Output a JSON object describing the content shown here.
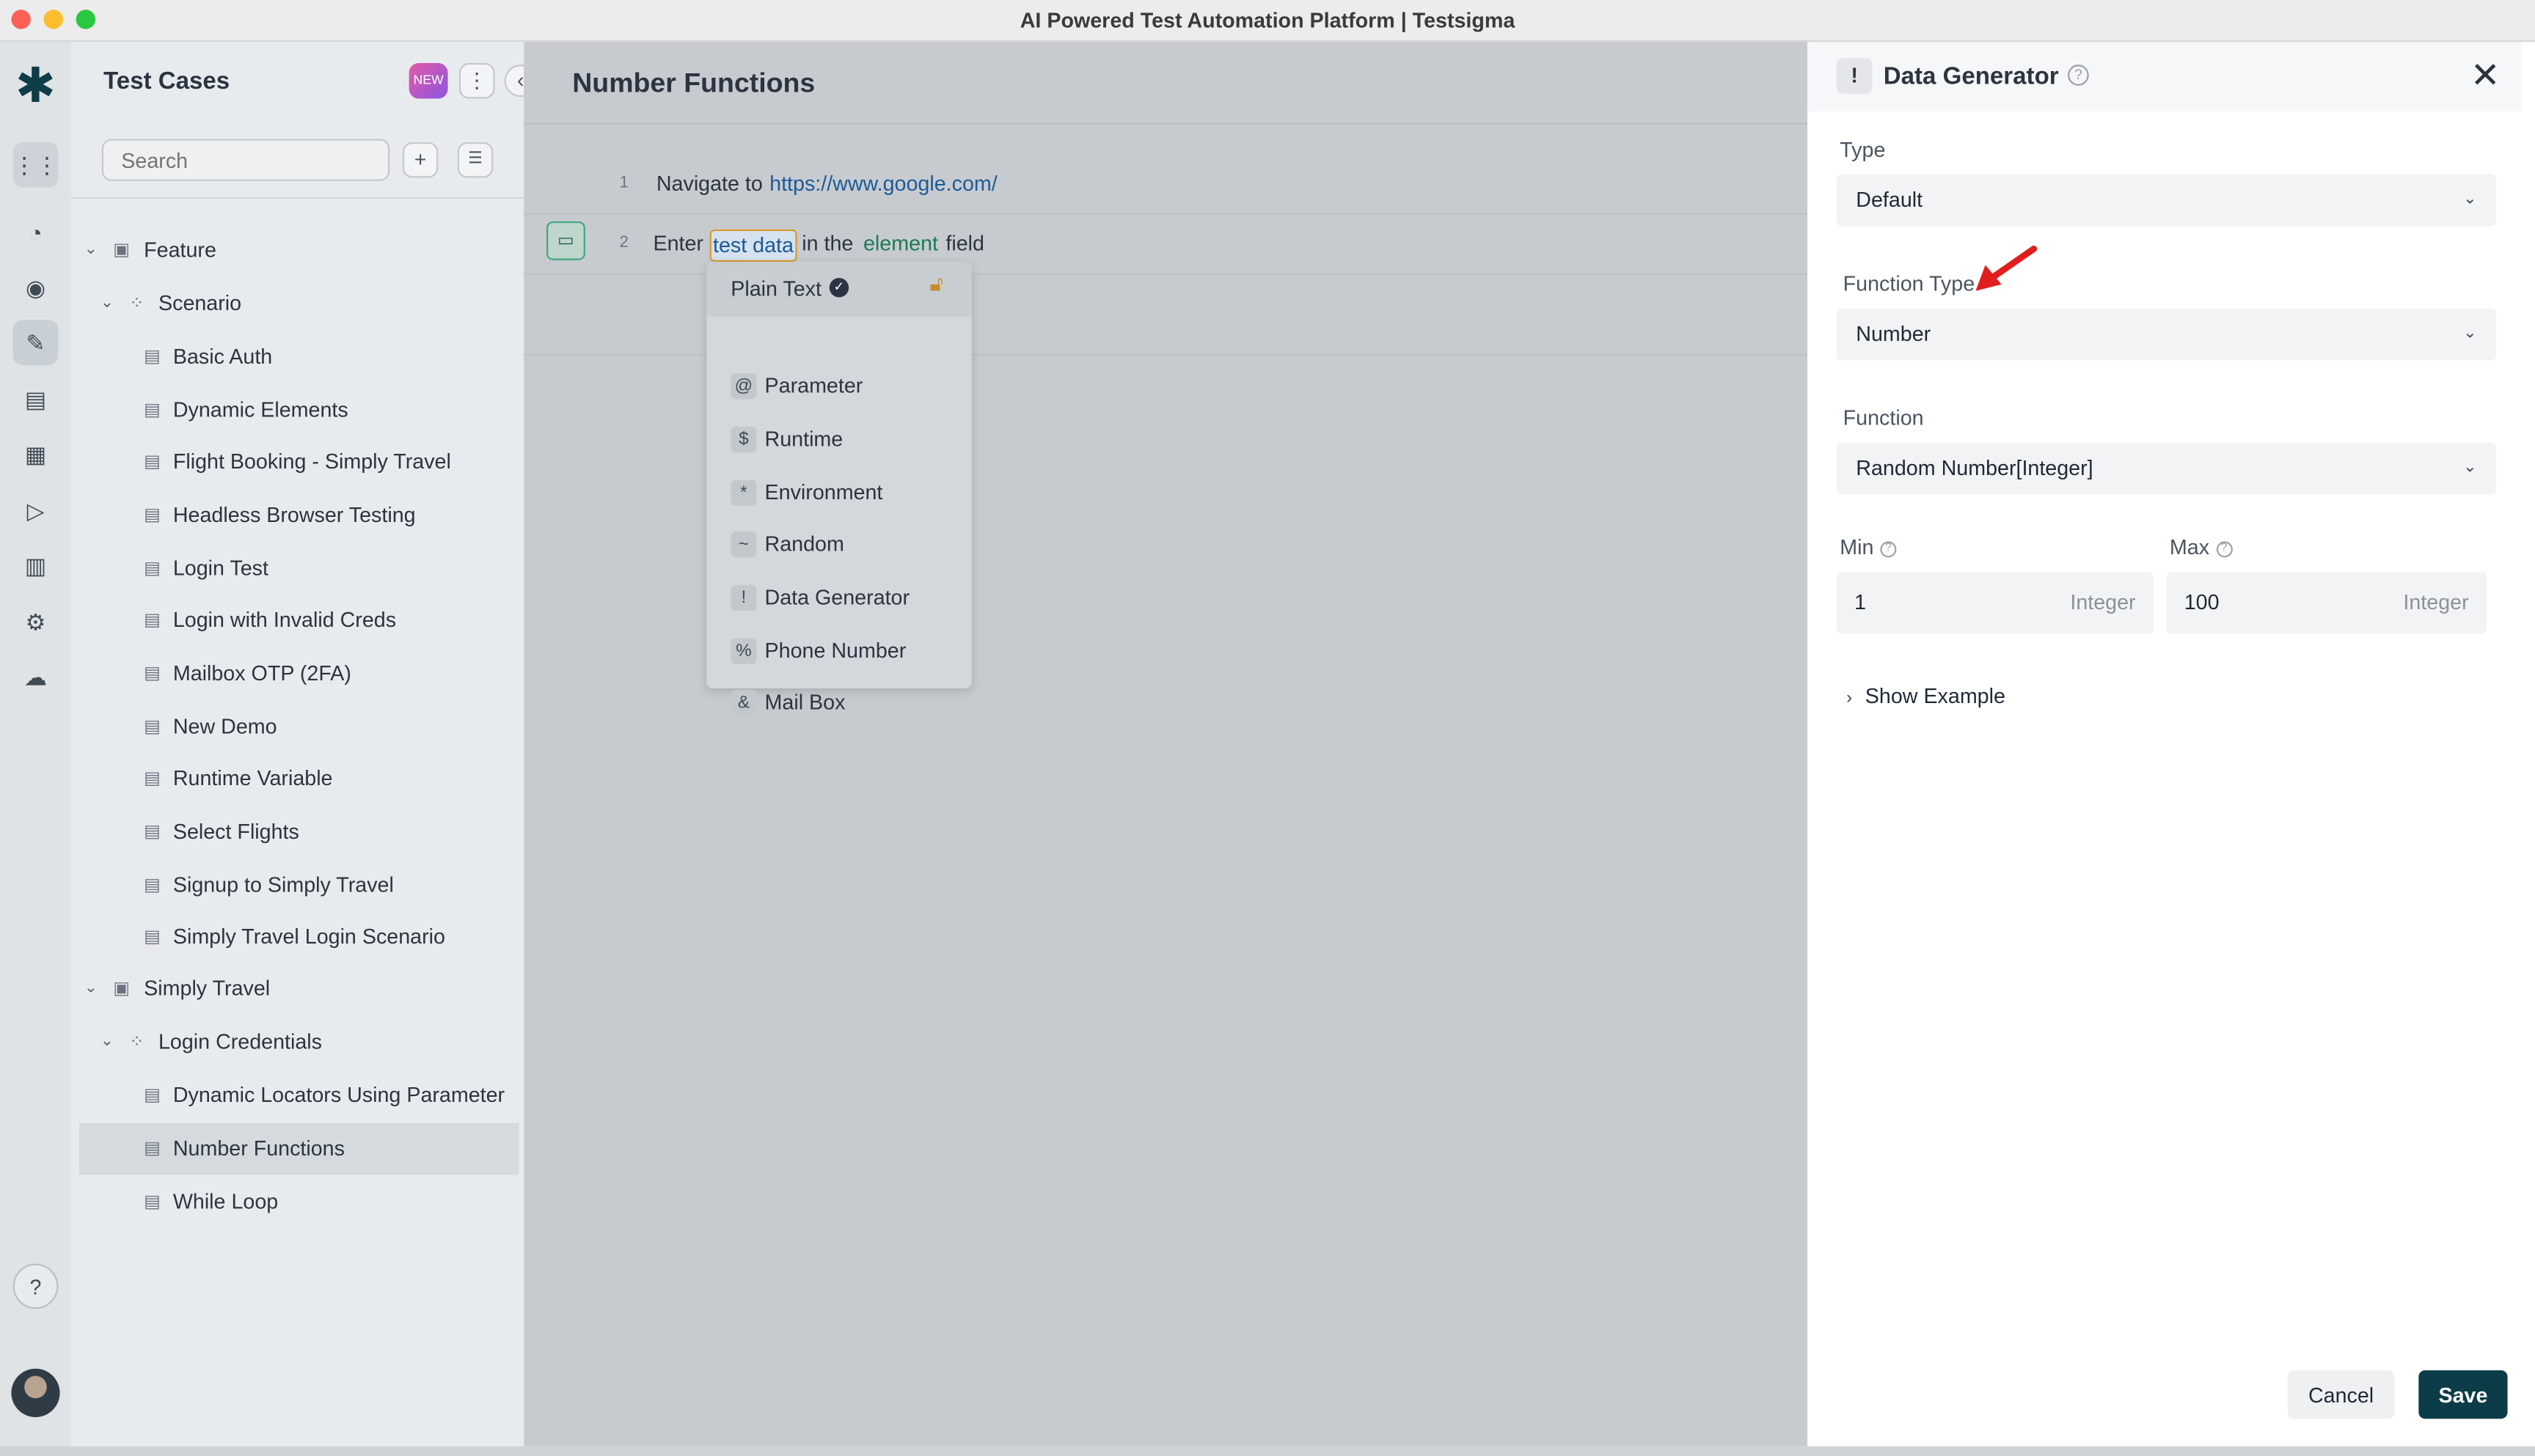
{
  "window": {
    "title": "AI Powered Test Automation Platform | Testsigma"
  },
  "rail": {
    "icons": [
      "testsigma-logo-icon",
      "apps-grid-icon",
      "dashboard-icon",
      "ai-agent-icon",
      "test-cases-icon",
      "test-data-icon",
      "elements-icon",
      "run-icon",
      "reports-icon",
      "settings-icon",
      "cloud-icon"
    ],
    "help_glyph": "?"
  },
  "sidebar": {
    "title": "Test Cases",
    "badge": "NEW",
    "search_placeholder": "Search",
    "add_glyph": "+",
    "checklist_glyph": "☰",
    "more_glyph": "⋮",
    "collapse_glyph": "‹",
    "tree": [
      {
        "label": "Feature",
        "type": "folder"
      },
      {
        "label": "Scenario",
        "type": "group"
      },
      {
        "label": "Basic Auth",
        "type": "case"
      },
      {
        "label": "Dynamic Elements",
        "type": "case"
      },
      {
        "label": "Flight Booking - Simply Travel",
        "type": "case"
      },
      {
        "label": "Headless Browser Testing",
        "type": "case"
      },
      {
        "label": "Login Test",
        "type": "case"
      },
      {
        "label": "Login with Invalid Creds",
        "type": "case"
      },
      {
        "label": "Mailbox OTP (2FA)",
        "type": "case"
      },
      {
        "label": "New Demo",
        "type": "case"
      },
      {
        "label": "Runtime Variable",
        "type": "case"
      },
      {
        "label": "Select Flights",
        "type": "case"
      },
      {
        "label": "Signup to Simply Travel",
        "type": "case"
      },
      {
        "label": "Simply Travel Login Scenario",
        "type": "case"
      },
      {
        "label": "Simply Travel",
        "type": "folder"
      },
      {
        "label": "Login Credentials",
        "type": "group"
      },
      {
        "label": "Dynamic Locators Using Parameter",
        "type": "case"
      },
      {
        "label": "Number Functions",
        "type": "case",
        "selected": true
      },
      {
        "label": "While Loop",
        "type": "case"
      }
    ]
  },
  "main": {
    "title": "Number Functions",
    "steps": [
      {
        "number": "1",
        "action": "Navigate to",
        "url": "https://www.google.com/"
      },
      {
        "number": "2",
        "action": "Enter",
        "test_data": "test data",
        "mid": "in the",
        "element": "element",
        "tail": "field"
      }
    ],
    "data_menu": {
      "first": "Plain Text",
      "items": [
        {
          "glyph": "@",
          "label": "Parameter"
        },
        {
          "glyph": "$",
          "label": "Runtime"
        },
        {
          "glyph": "*",
          "label": "Environment"
        },
        {
          "glyph": "~",
          "label": "Random"
        },
        {
          "glyph": "!",
          "label": "Data Generator"
        },
        {
          "glyph": "%",
          "label": "Phone Number"
        },
        {
          "glyph": "&",
          "label": "Mail Box"
        }
      ]
    }
  },
  "panel": {
    "icon_glyph": "!",
    "title": "Data Generator",
    "type_label": "Type",
    "type_value": "Default",
    "function_type_label": "Function Type",
    "function_type_value": "Number",
    "function_label": "Function",
    "function_value": "Random Number[Integer]",
    "min_label": "Min",
    "min_value": "1",
    "min_unit": "Integer",
    "max_label": "Max",
    "max_value": "100",
    "max_unit": "Integer",
    "show_example": "Show Example",
    "cancel": "Cancel",
    "save": "Save"
  },
  "colors": {
    "accent": "#0b3c47",
    "link": "#1e5a96",
    "element": "#1d7a52",
    "arrow": "#e11d1d"
  }
}
